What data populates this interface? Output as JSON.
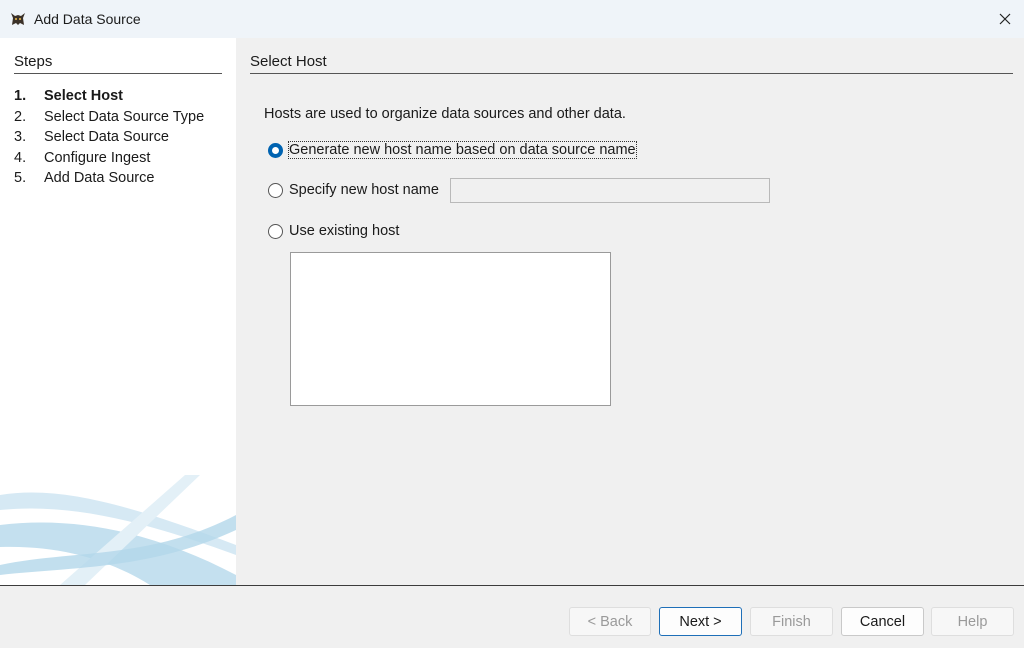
{
  "window": {
    "title": "Add Data Source",
    "icon": "autopsy-dog-icon"
  },
  "steps": {
    "header": "Steps",
    "items": [
      {
        "num": "1.",
        "label": "Select Host",
        "active": true
      },
      {
        "num": "2.",
        "label": "Select Data Source Type",
        "active": false
      },
      {
        "num": "3.",
        "label": "Select Data Source",
        "active": false
      },
      {
        "num": "4.",
        "label": "Configure Ingest",
        "active": false
      },
      {
        "num": "5.",
        "label": "Add Data Source",
        "active": false
      }
    ]
  },
  "main": {
    "title": "Select Host",
    "description": "Hosts are used to organize data sources and other data.",
    "options": {
      "generate": {
        "label": "Generate new host name based on data source name",
        "selected": true
      },
      "specify": {
        "label": "Specify new host name",
        "selected": false,
        "value": "",
        "placeholder": ""
      },
      "existing": {
        "label": "Use existing host",
        "selected": false,
        "hosts": []
      }
    }
  },
  "buttons": {
    "back": {
      "label": "< Back",
      "enabled": false
    },
    "next": {
      "label": "Next >",
      "enabled": true
    },
    "finish": {
      "label": "Finish",
      "enabled": false
    },
    "cancel": {
      "label": "Cancel",
      "enabled": true
    },
    "help": {
      "label": "Help",
      "enabled": false
    }
  },
  "colors": {
    "accent": "#0063b1",
    "title_bar": "#eff4f9",
    "panel": "#f0f0f0"
  }
}
